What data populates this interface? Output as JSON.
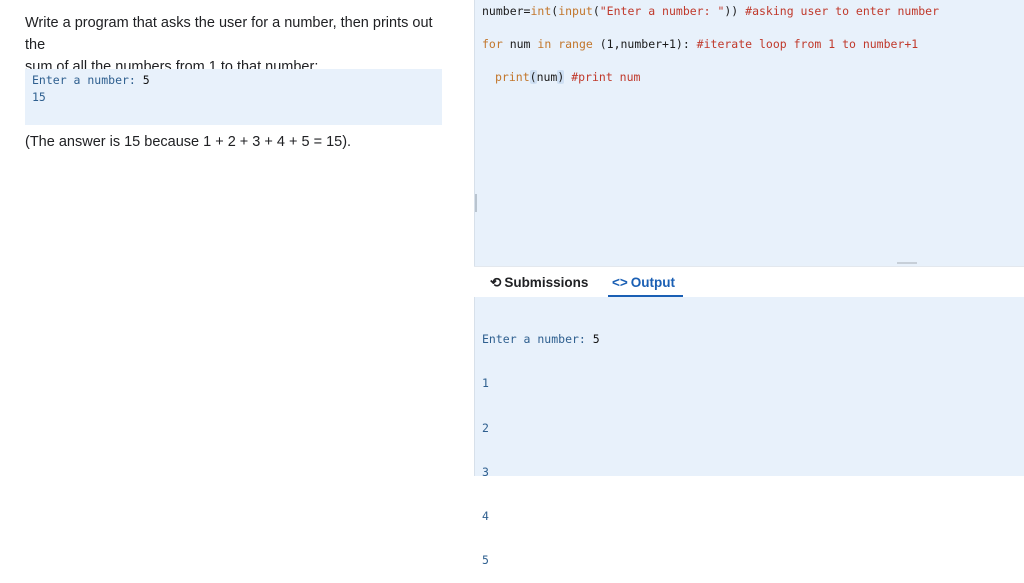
{
  "problem": {
    "line1": "Write a program that asks the user for a number, then prints out the",
    "line2": "sum of all the numbers from 1 to that number:",
    "sample_prompt": "Enter a number: ",
    "sample_input": "5",
    "sample_output": "15",
    "explanation": "(The answer is 15 because 1 + 2 + 3 + 4 + 5 = 15)."
  },
  "code": {
    "line1": {
      "var": "number=",
      "fn1": "int",
      "p1": "(",
      "fn2": "input",
      "p2": "(",
      "str": "\"Enter a number: \"",
      "p3": "))",
      "comment": " #asking user to enter number"
    },
    "line2": {
      "kw1": "for",
      "var": " num ",
      "kw2": "in",
      "fn": " range",
      "rest": " (1,number+1):",
      "comment": " #iterate loop from 1 to number+1"
    },
    "line3": {
      "fn": "print",
      "open": "(",
      "arg": "num",
      "close": ")",
      "comment": " #print num"
    }
  },
  "tabs": {
    "submissions_icon": "history-icon",
    "submissions_glyph": "⟲",
    "submissions": "Submissions",
    "output_icon": "code-icon",
    "output_glyph": "<>",
    "output": "Output"
  },
  "output": {
    "prompt": "Enter a number: ",
    "input": "5",
    "lines": [
      "1",
      "2",
      "3",
      "4",
      "5"
    ]
  },
  "colors": {
    "panel_bg": "#e8f1fb",
    "keyword": "#c2762b",
    "string": "#c0392b",
    "accent": "#1a5fb4"
  }
}
